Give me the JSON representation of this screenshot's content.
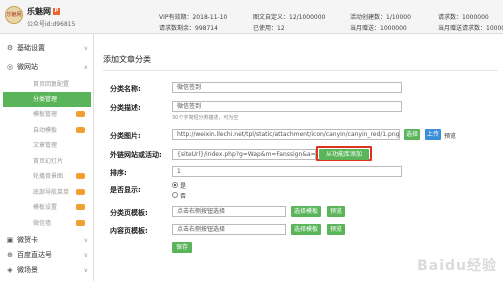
{
  "header": {
    "logo_text": "乐魅网",
    "brand": "乐魅网",
    "brand_tag": "P",
    "account": "公众号id:d96815",
    "stats": [
      {
        "text": "VIP有效期：2018-11-10"
      },
      {
        "text": "请求数剩余：998714"
      },
      {
        "text": "图文自定义：12/1000000"
      },
      {
        "text": "已使用：12"
      },
      {
        "text": "活动创建数：1/10000"
      },
      {
        "text": "当月赠送：1000000"
      },
      {
        "text": "请求数：1000000"
      },
      {
        "text": "当月赠送请求数：1000000"
      }
    ]
  },
  "sidebar": {
    "groups": [
      {
        "label": "基础设置",
        "icon": "gear-icon",
        "arrow": "∨"
      },
      {
        "label": "微网站",
        "icon": "site-icon",
        "arrow": "∧"
      },
      {
        "label": "微贺卡",
        "icon": "card-icon",
        "arrow": "∨"
      },
      {
        "label": "百度直达号",
        "icon": "baidu-icon",
        "arrow": "∨"
      },
      {
        "label": "微场景",
        "icon": "scene-icon",
        "arrow": "∨"
      }
    ],
    "items": [
      {
        "label": "首页回复配置",
        "active": false
      },
      {
        "label": "分类管理",
        "active": true
      },
      {
        "label": "模板管理",
        "active": false
      },
      {
        "label": "自动模板",
        "active": false
      },
      {
        "label": "文章管理",
        "active": false
      },
      {
        "label": "首页幻灯片",
        "active": false
      },
      {
        "label": "轮播背景图",
        "active": false
      },
      {
        "label": "底部导航菜单",
        "active": false
      },
      {
        "label": "模板设置",
        "active": false
      },
      {
        "label": "微信墙",
        "active": false
      }
    ]
  },
  "form": {
    "title": "添加文章分类",
    "name_label": "分类名称:",
    "name_value": "微信签到",
    "desc_label": "分类描述:",
    "desc_value": "微信签到",
    "desc_hint": "30个字简短分类描述，可为空",
    "image_label": "分类图片:",
    "image_value": "http://weixin.llechi.net/tpl/static/attachment/icon/canyin/canyin_red/1.png",
    "select_btn": "选择",
    "upload_btn": "上传",
    "preview_link": "预览",
    "outlink_label": "外链网站或活动:",
    "outlink_value": "{siteUrl}/index.php?g=Wap&m=Fanssign&a=in",
    "outlink_btn": "从功能库添加",
    "sort_label": "排序:",
    "sort_value": "1",
    "show_label": "是否显示:",
    "show_yes": "是",
    "show_no": "否",
    "list_tpl_label": "分类页模板:",
    "list_tpl_value": "点击右侧按钮选择",
    "list_tpl_btn": "选择模板",
    "list_tpl_preview": "预览",
    "content_tpl_label": "内容页模板:",
    "content_tpl_value": "点击右侧按钮选择",
    "content_tpl_btn": "选择模板",
    "content_tpl_preview": "预览",
    "save_btn": "保存"
  },
  "watermark": "Baidu经验"
}
